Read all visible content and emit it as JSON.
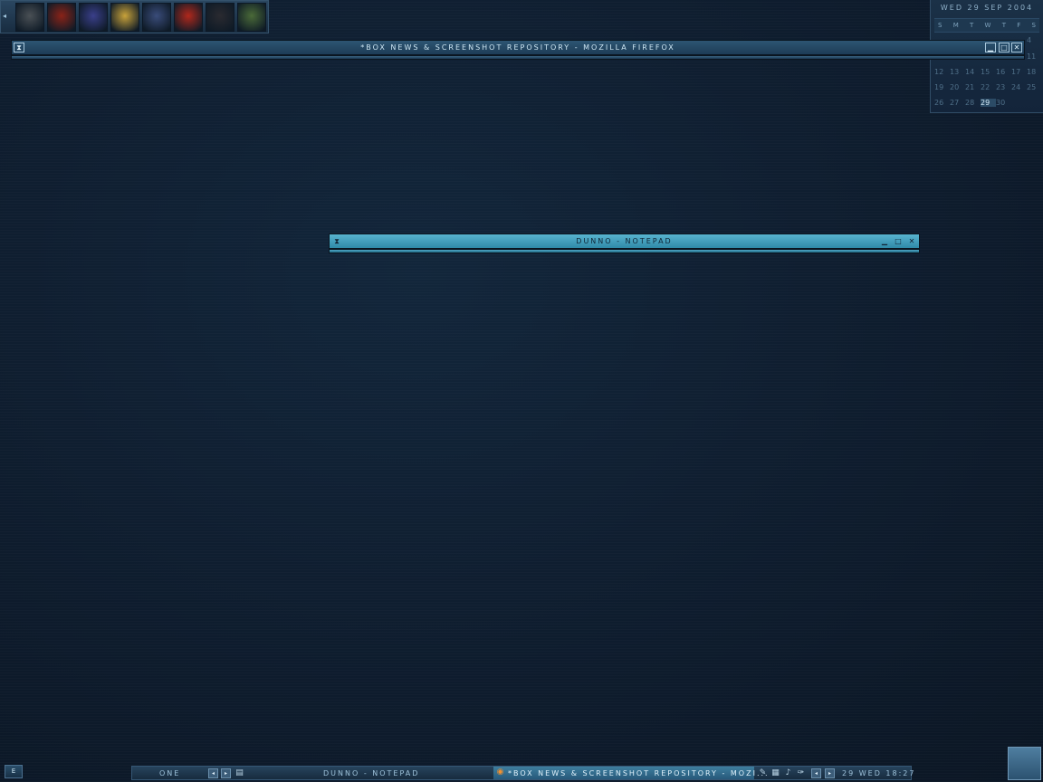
{
  "launcher": {
    "arrow_glyph": "◂",
    "icons": [
      {
        "name": "knight-icon",
        "color": "#4a5055"
      },
      {
        "name": "demon-icon",
        "color": "#8a2318"
      },
      {
        "name": "helmet-icon",
        "color": "#3a3f8a"
      },
      {
        "name": "counter-strike-icon",
        "color": "#c8a23a"
      },
      {
        "name": "unreal-icon",
        "color": "#3a4c7a"
      },
      {
        "name": "doom-icon",
        "color": "#b0281c"
      },
      {
        "name": "crosshair-icon",
        "color": "#2a2a30"
      },
      {
        "name": "orc-icon",
        "color": "#4a6a38"
      }
    ]
  },
  "calendar": {
    "date_text": "WED 29 SEP 2004",
    "weekdays": [
      "S",
      "M",
      "T",
      "W",
      "T",
      "F",
      "S"
    ],
    "partial_rows": [
      {
        "cells": [
          "4"
        ]
      },
      {
        "cells": [
          "11"
        ]
      }
    ],
    "rows": [
      {
        "cells": [
          "12",
          "13",
          "14",
          "15",
          "16",
          "17",
          "18"
        ]
      },
      {
        "cells": [
          "19",
          "20",
          "21",
          "22",
          "23",
          "24",
          "25"
        ]
      },
      {
        "cells": [
          "26",
          "27",
          "28",
          "29",
          "30"
        ]
      }
    ],
    "today": "29"
  },
  "firefox_window": {
    "title": "*BOX NEWS & SCREENSHOT REPOSITORY - MOZILLA FIREFOX",
    "menu_glyph": "⧗",
    "minimize_glyph": "▁",
    "maximize_glyph": "□",
    "close_glyph": "✕"
  },
  "notepad_window": {
    "title": "DUNNO - NOTEPAD",
    "menu_glyph": "⧗",
    "minimize_glyph": "▁",
    "maximize_glyph": "□",
    "close_glyph": "✕"
  },
  "taskbar": {
    "left_menu_label": "E",
    "workspace": "ONE",
    "prev_glyph": "◂",
    "next_glyph": "▸",
    "tasks": [
      {
        "label": "DUNNO - NOTEPAD"
      },
      {
        "label": "*BOX NEWS & SCREENSHOT REPOSITORY - MOZI..."
      }
    ],
    "tray_icons": [
      "pen-icon",
      "printer-icon",
      "pipe-icon",
      "feather-icon"
    ],
    "clock": "29 WED 18:27"
  },
  "colors": {
    "accent_active": "#4fa8c6",
    "desktop": "#0f1e30"
  }
}
